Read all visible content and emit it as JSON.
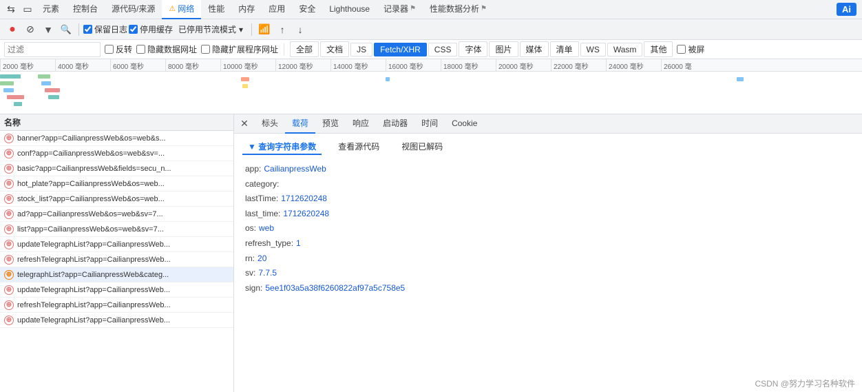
{
  "topToolbar": {
    "icons": [
      "cursor-icon",
      "rect-icon"
    ],
    "menus": [
      "元素",
      "控制台",
      "源代码/来源",
      "网络",
      "性能",
      "内存",
      "应用",
      "安全",
      "Lighthouse",
      "记录器",
      "性能数据分析"
    ],
    "networkActive": true,
    "stopRecordLabel": "●",
    "clearLabel": "🚫",
    "filterLabel": "▼",
    "searchLabel": "🔍",
    "keepLogLabel": "保留日志",
    "disableCacheLabel": "停用缓存",
    "modeLabel": "已停用节流模式",
    "dropdownLabel": "▾",
    "wifiLabel": "📶",
    "uploadLabel": "↑",
    "downloadLabel": "↓",
    "aiLabel": "Ai"
  },
  "filterRow": {
    "filterPlaceholder": "过滤",
    "reverseLabel": "反转",
    "hideDataUrlsLabel": "隐藏数据网址",
    "hideExtensionsLabel": "隐藏扩展程序网址",
    "buttons": [
      "全部",
      "文档",
      "JS",
      "Fetch/XHR",
      "CSS",
      "字体",
      "图片",
      "媒体",
      "清单",
      "WS",
      "Wasm",
      "其他"
    ],
    "activeButton": "Fetch/XHR",
    "blockedLabel": "被屏"
  },
  "timeline": {
    "ticks": [
      "2000 毫秒",
      "4000 毫秒",
      "6000 毫秒",
      "8000 毫秒",
      "10000 毫秒",
      "12000 毫秒",
      "14000 毫秒",
      "16000 毫秒",
      "18000 毫秒",
      "20000 毫秒",
      "22000 毫秒",
      "24000 毫秒",
      "26000 毫"
    ]
  },
  "networkList": {
    "header": "名称",
    "items": [
      {
        "name": "banner?app=CailianpressWeb&os=web&s...",
        "icon": "xhr",
        "color": "red"
      },
      {
        "name": "conf?app=CailianpressWeb&os=web&sv=...",
        "icon": "xhr",
        "color": "red"
      },
      {
        "name": "basic?app=CailianpressWeb&fields=secu_n...",
        "icon": "xhr",
        "color": "red"
      },
      {
        "name": "hot_plate?app=CailianpressWeb&os=web...",
        "icon": "xhr",
        "color": "red"
      },
      {
        "name": "stock_list?app=CailianpressWeb&os=web...",
        "icon": "xhr",
        "color": "red"
      },
      {
        "name": "ad?app=CailianpressWeb&os=web&sv=7...",
        "icon": "xhr",
        "color": "red"
      },
      {
        "name": "list?app=CailianpressWeb&os=web&sv=7...",
        "icon": "xhr",
        "color": "red"
      },
      {
        "name": "updateTelegraphList?app=CailianpressWeb...",
        "icon": "xhr",
        "color": "red"
      },
      {
        "name": "refreshTelegraphList?app=CailianpressWeb...",
        "icon": "xhr",
        "color": "red"
      },
      {
        "name": "telegraphList?app=CailianpressWeb&categ...",
        "icon": "xhr",
        "color": "orange",
        "selected": true
      },
      {
        "name": "updateTelegraphList?app=CailianpressWeb...",
        "icon": "xhr",
        "color": "red"
      },
      {
        "name": "refreshTelegraphList?app=CailianpressWeb...",
        "icon": "xhr",
        "color": "red"
      },
      {
        "name": "updateTelegraphList?app=CailianpressWeb...",
        "icon": "xhr",
        "color": "red"
      }
    ]
  },
  "detailPanel": {
    "tabs": [
      "标头",
      "载荷",
      "预览",
      "响应",
      "启动器",
      "时间",
      "Cookie"
    ],
    "activeTab": "载荷",
    "subTabs": [
      "查询字符串参数",
      "查看源代码",
      "视图已解码"
    ],
    "activeSubTab": "查询字符串参数",
    "params": [
      {
        "key": "app:",
        "value": "CailianpressWeb"
      },
      {
        "key": "category:",
        "value": ""
      },
      {
        "key": "lastTime:",
        "value": "1712620248"
      },
      {
        "key": "last_time:",
        "value": "1712620248"
      },
      {
        "key": "os:",
        "value": "web"
      },
      {
        "key": "refresh_type:",
        "value": "1"
      },
      {
        "key": "rn:",
        "value": "20"
      },
      {
        "key": "sv:",
        "value": "7.7.5"
      },
      {
        "key": "sign:",
        "value": "5ee1f03a5a38f6260822af97a5c758e5"
      }
    ]
  },
  "watermark": "CSDN @努力学习名种软件"
}
